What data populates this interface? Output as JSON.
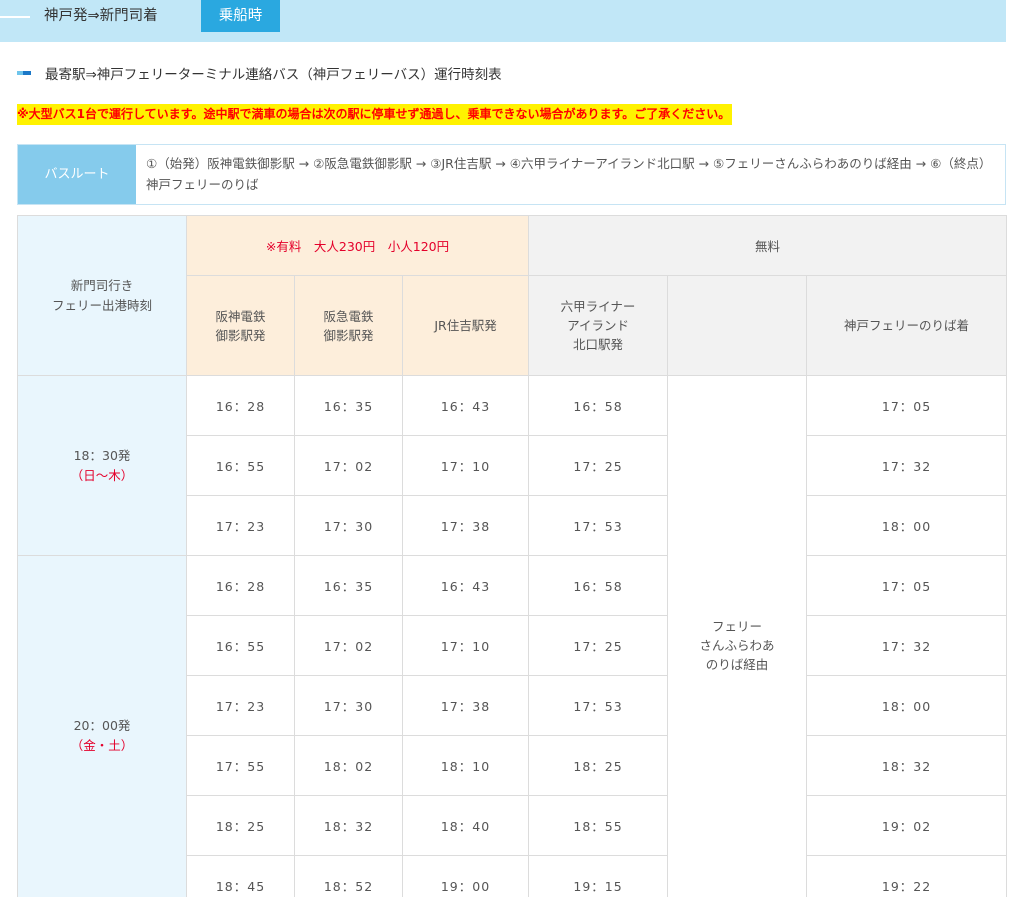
{
  "header": {
    "route": "神戸発⇒新門司着",
    "badge": "乗船時"
  },
  "section_title": "最寄駅⇒神戸フェリーターミナル連絡バス（神戸フェリーバス）運行時刻表",
  "notice": "※大型バス1台で運行しています。途中駅で満車の場合は次の駅に停車せず通過し、乗車できない場合があります。ご了承ください。",
  "bus_route": {
    "label": "バスルート",
    "stops": "①（始発）阪神電鉄御影駅 → ②阪急電鉄御影駅 → ③JR住吉駅 → ④六甲ライナーアイランド北口駅 → ⑤フェリーさんふらわあのりば経由 → ⑥（終点）神戸フェリーのりば"
  },
  "colors": {
    "top_bar": "#c1e7f7",
    "badge": "#2aa8e0",
    "paid_bg": "#fdeedb",
    "free_bg": "#f2f2f2",
    "side_bg": "#e9f6fd",
    "accent_red": "#e4002b"
  },
  "timetable": {
    "departure_header_line1": "新門司行き",
    "departure_header_line2": "フェリー出港時刻",
    "paid_header": "※有料　大人230円　小人120円",
    "free_header": "無料",
    "columns": {
      "hanshin": [
        "阪神電鉄",
        "御影駅発"
      ],
      "hankyu": [
        "阪急電鉄",
        "御影駅発"
      ],
      "jr": "JR住吉駅発",
      "rokko": [
        "六甲ライナー",
        "アイランド",
        "北口駅発"
      ],
      "terminal": "神戸フェリーのりば着"
    },
    "via": [
      "フェリー",
      "さんふらわあ",
      "のりば経由"
    ],
    "groups": [
      {
        "time": "18：30発",
        "days": "（日～木）",
        "rows": [
          [
            "16：28",
            "16：35",
            "16：43",
            "16：58",
            "17：05"
          ],
          [
            "16：55",
            "17：02",
            "17：10",
            "17：25",
            "17：32"
          ],
          [
            "17：23",
            "17：30",
            "17：38",
            "17：53",
            "18：00"
          ]
        ]
      },
      {
        "time": "20：00発",
        "days": "（金・土）",
        "rows": [
          [
            "16：28",
            "16：35",
            "16：43",
            "16：58",
            "17：05"
          ],
          [
            "16：55",
            "17：02",
            "17：10",
            "17：25",
            "17：32"
          ],
          [
            "17：23",
            "17：30",
            "17：38",
            "17：53",
            "18：00"
          ],
          [
            "17：55",
            "18：02",
            "18：10",
            "18：25",
            "18：32"
          ],
          [
            "18：25",
            "18：32",
            "18：40",
            "18：55",
            "19：02"
          ],
          [
            "18：45",
            "18：52",
            "19：00",
            "19：15",
            "19：22"
          ]
        ]
      }
    ]
  }
}
